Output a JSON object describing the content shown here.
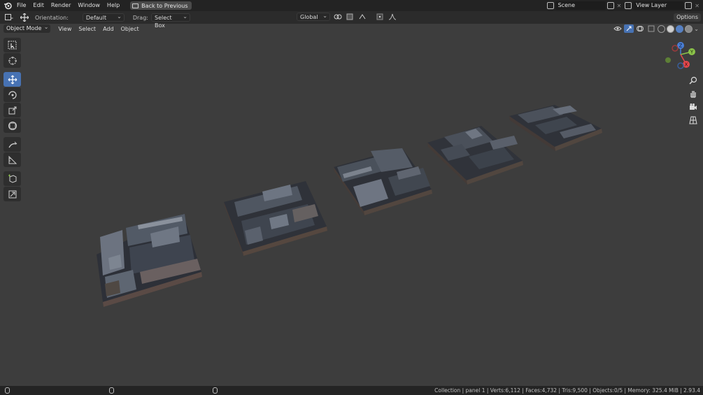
{
  "menubar": {
    "items": [
      "File",
      "Edit",
      "Render",
      "Window",
      "Help"
    ],
    "back_button": "Back to Previous",
    "scene": "Scene",
    "view_layer": "View Layer"
  },
  "tool_header": {
    "orientation_label": "Orientation:",
    "orientation_value": "Default",
    "drag_label": "Drag:",
    "drag_value": "Select Box",
    "transform_orientation": "Global",
    "options_label": "Options"
  },
  "viewport_header": {
    "mode": "Object Mode",
    "menus": [
      "View",
      "Select",
      "Add",
      "Object"
    ]
  },
  "toolbar": {
    "tools": [
      "select-box-icon",
      "cursor-icon",
      "move-icon",
      "rotate-icon",
      "scale-icon",
      "transform-icon",
      "annotate-icon",
      "measure-icon",
      "add-cube-icon",
      "scale-cage-icon"
    ],
    "active_tool": "move-icon"
  },
  "gizmo": {
    "axes": [
      "Z",
      "Y",
      "X"
    ],
    "colors": {
      "x": "#e5484d",
      "y": "#8bc34a",
      "z": "#4a7fd6"
    }
  },
  "status": {
    "text": "Collection | panel 1 | Verts:6,112 | Faces:4,732 | Tris:9,500 | Objects:0/5 | Memory: 325.4 MiB | 2.93.4"
  },
  "colors": {
    "accent": "#4772b3",
    "viewport_bg": "#3d3d3d"
  }
}
